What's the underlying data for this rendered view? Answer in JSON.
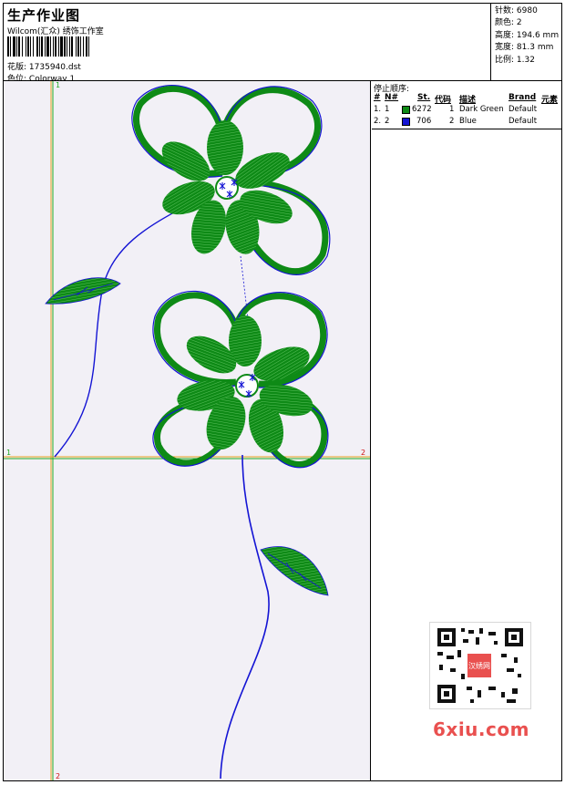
{
  "header": {
    "title": "生产作业图",
    "company": "Wilcom(汇众) 绣饰工作室",
    "design_label": "花版:",
    "design_value": "1735940.dst",
    "colorway_label": "色位:",
    "colorway_value": "Colorway 1"
  },
  "stats": [
    {
      "label": "针数",
      "value": "6980"
    },
    {
      "label": "颜色",
      "value": "2"
    },
    {
      "label": "高度",
      "value": "194.6 mm"
    },
    {
      "label": "宽度",
      "value": "81.3 mm"
    },
    {
      "label": "比例",
      "value": "1.32"
    }
  ],
  "stop_sequence": {
    "title": "停止顺序:",
    "headers": {
      "hash": "#",
      "n": "N#",
      "st": "St.",
      "code": "代码",
      "desc": "描述",
      "brand": "Brand",
      "elem": "元素"
    },
    "rows": [
      {
        "index": "1.",
        "n": "1",
        "color": "#0e8a16",
        "stitches": "6272",
        "code": "1",
        "desc": "Dark Green",
        "brand": "Default"
      },
      {
        "index": "2.",
        "n": "2",
        "color": "#1414d4",
        "stitches": "706",
        "code": "2",
        "desc": "Blue",
        "brand": "Default"
      }
    ]
  },
  "guides": {
    "v_top": "1",
    "v_bottom": "2",
    "h_left": "1",
    "h_right": "2"
  },
  "watermark": "6xiu.com",
  "qr_badge": "汉绣网",
  "colors": {
    "thread_green": "#0e8a16",
    "thread_blue": "#1414d4",
    "canvas_bg": "#f2f0f6"
  }
}
